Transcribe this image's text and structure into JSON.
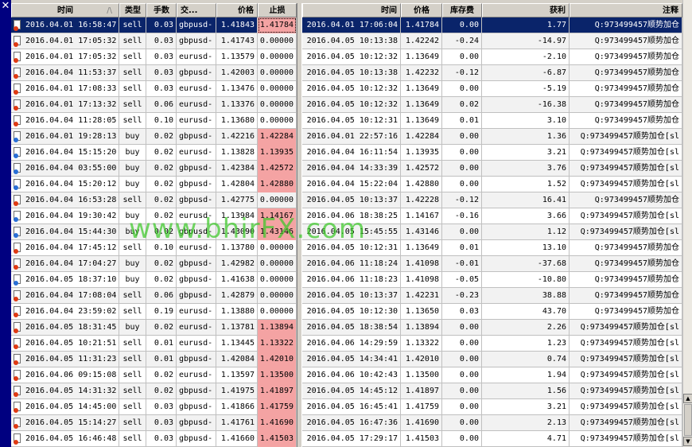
{
  "headers": {
    "open_time": "时间",
    "type": "类型",
    "lots": "手数",
    "symbol": "交...",
    "open_price": "价格",
    "stop_loss": "止损",
    "close_time": "时间",
    "close_price": "价格",
    "swap": "库存费",
    "profit": "获利",
    "comment": "注释",
    "sort_indicator": "/\\"
  },
  "close_glyph": "✕",
  "watermark": "www.bhirFX.com",
  "colors": {
    "selection": "#0a246a",
    "stop_loss_hit": "#f4a3a3",
    "sell_dot": "#e03a14",
    "buy_dot": "#2a6fd6"
  },
  "rows": [
    {
      "open_time": "2016.04.01 16:58:47",
      "type": "sell",
      "lots": "0.03",
      "symbol": "gbpusd-",
      "open_price": "1.41843",
      "sl": "1.41784",
      "sl_hit": true,
      "close_time": "2016.04.01 17:06:04",
      "close_price": "1.41784",
      "swap": "0.00",
      "profit": "1.77",
      "comment": "Q:973499457顺势加仓",
      "icon": "sell"
    },
    {
      "open_time": "2016.04.01 17:05:32",
      "type": "sell",
      "lots": "0.03",
      "symbol": "gbpusd-",
      "open_price": "1.41743",
      "sl": "0.00000",
      "sl_hit": false,
      "close_time": "2016.04.05 10:13:38",
      "close_price": "1.42242",
      "swap": "-0.24",
      "profit": "-14.97",
      "comment": "Q:973499457顺势加仓",
      "icon": "sell"
    },
    {
      "open_time": "2016.04.01 17:05:32",
      "type": "sell",
      "lots": "0.03",
      "symbol": "eurusd-",
      "open_price": "1.13579",
      "sl": "0.00000",
      "sl_hit": false,
      "close_time": "2016.04.05 10:12:32",
      "close_price": "1.13649",
      "swap": "0.00",
      "profit": "-2.10",
      "comment": "Q:973499457顺势加仓",
      "icon": "sell"
    },
    {
      "open_time": "2016.04.04 11:53:37",
      "type": "sell",
      "lots": "0.03",
      "symbol": "gbpusd-",
      "open_price": "1.42003",
      "sl": "0.00000",
      "sl_hit": false,
      "close_time": "2016.04.05 10:13:38",
      "close_price": "1.42232",
      "swap": "-0.12",
      "profit": "-6.87",
      "comment": "Q:973499457顺势加仓",
      "icon": "sell"
    },
    {
      "open_time": "2016.04.01 17:08:33",
      "type": "sell",
      "lots": "0.03",
      "symbol": "eurusd-",
      "open_price": "1.13476",
      "sl": "0.00000",
      "sl_hit": false,
      "close_time": "2016.04.05 10:12:32",
      "close_price": "1.13649",
      "swap": "0.00",
      "profit": "-5.19",
      "comment": "Q:973499457顺势加仓",
      "icon": "sell"
    },
    {
      "open_time": "2016.04.01 17:13:32",
      "type": "sell",
      "lots": "0.06",
      "symbol": "eurusd-",
      "open_price": "1.13376",
      "sl": "0.00000",
      "sl_hit": false,
      "close_time": "2016.04.05 10:12:32",
      "close_price": "1.13649",
      "swap": "0.02",
      "profit": "-16.38",
      "comment": "Q:973499457顺势加仓",
      "icon": "sell"
    },
    {
      "open_time": "2016.04.04 11:28:05",
      "type": "sell",
      "lots": "0.10",
      "symbol": "eurusd-",
      "open_price": "1.13680",
      "sl": "0.00000",
      "sl_hit": false,
      "close_time": "2016.04.05 10:12:31",
      "close_price": "1.13649",
      "swap": "0.01",
      "profit": "3.10",
      "comment": "Q:973499457顺势加仓",
      "icon": "sell"
    },
    {
      "open_time": "2016.04.01 19:28:13",
      "type": "buy",
      "lots": "0.02",
      "symbol": "gbpusd-",
      "open_price": "1.42216",
      "sl": "1.42284",
      "sl_hit": true,
      "close_time": "2016.04.01 22:57:16",
      "close_price": "1.42284",
      "swap": "0.00",
      "profit": "1.36",
      "comment": "Q:973499457顺势加仓[sl",
      "icon": "buy"
    },
    {
      "open_time": "2016.04.04 15:15:20",
      "type": "buy",
      "lots": "0.02",
      "symbol": "eurusd-",
      "open_price": "1.13828",
      "sl": "1.13935",
      "sl_hit": true,
      "close_time": "2016.04.04 16:11:54",
      "close_price": "1.13935",
      "swap": "0.00",
      "profit": "3.21",
      "comment": "Q:973499457顺势加仓[sl",
      "icon": "buy"
    },
    {
      "open_time": "2016.04.04 03:55:00",
      "type": "buy",
      "lots": "0.02",
      "symbol": "gbpusd-",
      "open_price": "1.42384",
      "sl": "1.42572",
      "sl_hit": true,
      "close_time": "2016.04.04 14:33:39",
      "close_price": "1.42572",
      "swap": "0.00",
      "profit": "3.76",
      "comment": "Q:973499457顺势加仓[sl",
      "icon": "buy"
    },
    {
      "open_time": "2016.04.04 15:20:12",
      "type": "buy",
      "lots": "0.02",
      "symbol": "gbpusd-",
      "open_price": "1.42804",
      "sl": "1.42880",
      "sl_hit": true,
      "close_time": "2016.04.04 15:22:04",
      "close_price": "1.42880",
      "swap": "0.00",
      "profit": "1.52",
      "comment": "Q:973499457顺势加仓[sl",
      "icon": "buy"
    },
    {
      "open_time": "2016.04.04 16:53:28",
      "type": "sell",
      "lots": "0.02",
      "symbol": "gbpusd-",
      "open_price": "1.42775",
      "sl": "0.00000",
      "sl_hit": false,
      "close_time": "2016.04.05 10:13:37",
      "close_price": "1.42228",
      "swap": "-0.12",
      "profit": "16.41",
      "comment": "Q:973499457顺势加仓",
      "icon": "sell"
    },
    {
      "open_time": "2016.04.04 19:30:42",
      "type": "buy",
      "lots": "0.02",
      "symbol": "eurusd-",
      "open_price": "1.13984",
      "sl": "1.14167",
      "sl_hit": true,
      "close_time": "2016.04.06 18:38:25",
      "close_price": "1.14167",
      "swap": "-0.16",
      "profit": "3.66",
      "comment": "Q:973499457顺势加仓[sl",
      "icon": "buy"
    },
    {
      "open_time": "2016.04.04 15:44:30",
      "type": "buy",
      "lots": "0.02",
      "symbol": "gbpusd-",
      "open_price": "1.43090",
      "sl": "1.43146",
      "sl_hit": true,
      "close_time": "2016.04.05 15:45:55",
      "close_price": "1.43146",
      "swap": "0.00",
      "profit": "1.12",
      "comment": "Q:973499457顺势加仓[sl",
      "icon": "buy"
    },
    {
      "open_time": "2016.04.04 17:45:12",
      "type": "sell",
      "lots": "0.10",
      "symbol": "eurusd-",
      "open_price": "1.13780",
      "sl": "0.00000",
      "sl_hit": false,
      "close_time": "2016.04.05 10:12:31",
      "close_price": "1.13649",
      "swap": "0.01",
      "profit": "13.10",
      "comment": "Q:973499457顺势加仓",
      "icon": "sell"
    },
    {
      "open_time": "2016.04.04 17:04:27",
      "type": "buy",
      "lots": "0.02",
      "symbol": "gbpusd-",
      "open_price": "1.42982",
      "sl": "0.00000",
      "sl_hit": false,
      "close_time": "2016.04.06 11:18:24",
      "close_price": "1.41098",
      "swap": "-0.01",
      "profit": "-37.68",
      "comment": "Q:973499457顺势加仓",
      "icon": "sell"
    },
    {
      "open_time": "2016.04.05 18:37:10",
      "type": "buy",
      "lots": "0.02",
      "symbol": "gbpusd-",
      "open_price": "1.41638",
      "sl": "0.00000",
      "sl_hit": false,
      "close_time": "2016.04.06 11:18:23",
      "close_price": "1.41098",
      "swap": "-0.05",
      "profit": "-10.80",
      "comment": "Q:973499457顺势加仓",
      "icon": "buy"
    },
    {
      "open_time": "2016.04.04 17:08:04",
      "type": "sell",
      "lots": "0.06",
      "symbol": "gbpusd-",
      "open_price": "1.42879",
      "sl": "0.00000",
      "sl_hit": false,
      "close_time": "2016.04.05 10:13:37",
      "close_price": "1.42231",
      "swap": "-0.23",
      "profit": "38.88",
      "comment": "Q:973499457顺势加仓",
      "icon": "sell"
    },
    {
      "open_time": "2016.04.04 23:59:02",
      "type": "sell",
      "lots": "0.19",
      "symbol": "eurusd-",
      "open_price": "1.13880",
      "sl": "0.00000",
      "sl_hit": false,
      "close_time": "2016.04.05 10:12:30",
      "close_price": "1.13650",
      "swap": "0.03",
      "profit": "43.70",
      "comment": "Q:973499457顺势加仓",
      "icon": "sell"
    },
    {
      "open_time": "2016.04.05 18:31:45",
      "type": "buy",
      "lots": "0.02",
      "symbol": "eurusd-",
      "open_price": "1.13781",
      "sl": "1.13894",
      "sl_hit": true,
      "close_time": "2016.04.05 18:38:54",
      "close_price": "1.13894",
      "swap": "0.00",
      "profit": "2.26",
      "comment": "Q:973499457顺势加仓[sl",
      "icon": "sell"
    },
    {
      "open_time": "2016.04.05 10:21:51",
      "type": "sell",
      "lots": "0.01",
      "symbol": "eurusd-",
      "open_price": "1.13445",
      "sl": "1.13322",
      "sl_hit": true,
      "close_time": "2016.04.06 14:29:59",
      "close_price": "1.13322",
      "swap": "0.00",
      "profit": "1.23",
      "comment": "Q:973499457顺势加仓[sl",
      "icon": "sell"
    },
    {
      "open_time": "2016.04.05 11:31:23",
      "type": "sell",
      "lots": "0.01",
      "symbol": "gbpusd-",
      "open_price": "1.42084",
      "sl": "1.42010",
      "sl_hit": true,
      "close_time": "2016.04.05 14:34:41",
      "close_price": "1.42010",
      "swap": "0.00",
      "profit": "0.74",
      "comment": "Q:973499457顺势加仓[sl",
      "icon": "sell"
    },
    {
      "open_time": "2016.04.06 09:15:08",
      "type": "sell",
      "lots": "0.02",
      "symbol": "eurusd-",
      "open_price": "1.13597",
      "sl": "1.13500",
      "sl_hit": true,
      "close_time": "2016.04.06 10:42:43",
      "close_price": "1.13500",
      "swap": "0.00",
      "profit": "1.94",
      "comment": "Q:973499457顺势加仓[sl",
      "icon": "sell"
    },
    {
      "open_time": "2016.04.05 14:31:32",
      "type": "sell",
      "lots": "0.02",
      "symbol": "gbpusd-",
      "open_price": "1.41975",
      "sl": "1.41897",
      "sl_hit": true,
      "close_time": "2016.04.05 14:45:12",
      "close_price": "1.41897",
      "swap": "0.00",
      "profit": "1.56",
      "comment": "Q:973499457顺势加仓[sl",
      "icon": "sell"
    },
    {
      "open_time": "2016.04.05 14:45:00",
      "type": "sell",
      "lots": "0.03",
      "symbol": "gbpusd-",
      "open_price": "1.41866",
      "sl": "1.41759",
      "sl_hit": true,
      "close_time": "2016.04.05 16:45:41",
      "close_price": "1.41759",
      "swap": "0.00",
      "profit": "3.21",
      "comment": "Q:973499457顺势加仓[sl",
      "icon": "sell"
    },
    {
      "open_time": "2016.04.05 15:14:27",
      "type": "sell",
      "lots": "0.03",
      "symbol": "gbpusd-",
      "open_price": "1.41761",
      "sl": "1.41690",
      "sl_hit": true,
      "close_time": "2016.04.05 16:47:36",
      "close_price": "1.41690",
      "swap": "0.00",
      "profit": "2.13",
      "comment": "Q:973499457顺势加仓[sl",
      "icon": "sell"
    },
    {
      "open_time": "2016.04.05 16:46:48",
      "type": "sell",
      "lots": "0.03",
      "symbol": "gbpusd-",
      "open_price": "1.41660",
      "sl": "1.41503",
      "sl_hit": true,
      "close_time": "2016.04.05 17:29:17",
      "close_price": "1.41503",
      "swap": "0.00",
      "profit": "4.71",
      "comment": "Q:973499457顺势加仓[sl",
      "icon": "sell"
    }
  ]
}
